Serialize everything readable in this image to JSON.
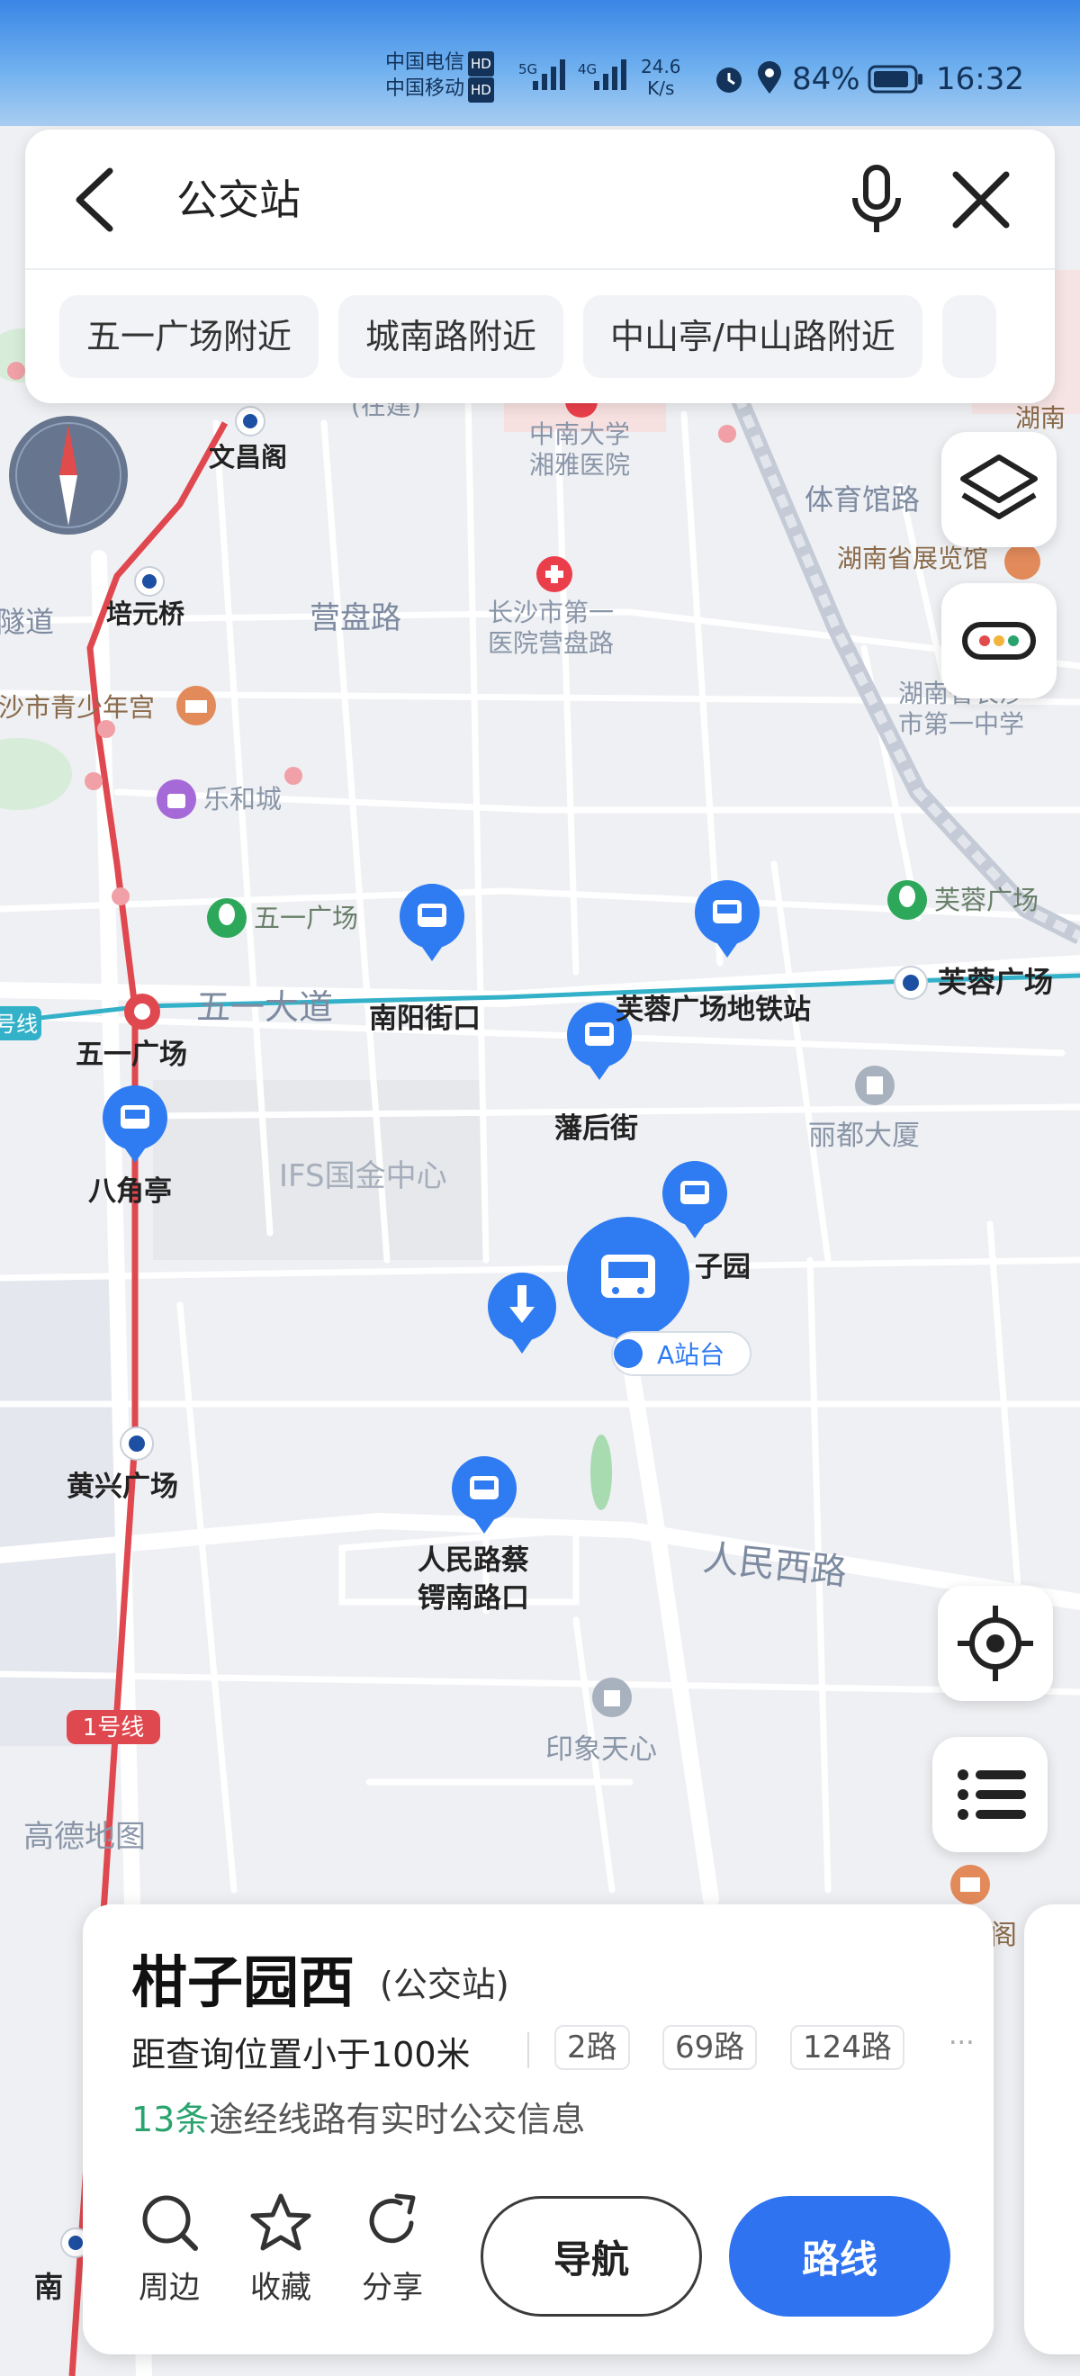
{
  "status_bar": {
    "carrier1": "中国电信",
    "carrier2": "中国移动",
    "hd": "HD",
    "net1": "5G",
    "net2": "4G",
    "speed_value": "24.6",
    "speed_unit": "K/s",
    "battery": "84%",
    "time": "16:32"
  },
  "search": {
    "query": "公交站",
    "chips": [
      "五一广场附近",
      "城南路附近",
      "中山亭/中山路附近"
    ]
  },
  "map": {
    "watermark": "高德地图",
    "labels": {
      "wenchangge": "文昌阁",
      "peiyuanqiao": "培元桥",
      "suidao": "隧道",
      "yingpanlu": "营盘路",
      "xiangya": "中南大学\n湘雅医院",
      "zaijian": "(在建)",
      "tiyuguan": "体育馆路",
      "hospital1": "长沙市第一\n医院营盘路",
      "zhanlanguan": "湖南省展览馆",
      "hunan_prefix": "湖南",
      "school1": "湖南省长沙\n市第一中学",
      "youthpalace": "沙市青少年宫",
      "leHeCheng": "乐和城",
      "furong_square": "芙蓉广场",
      "wuyi_square_poi": "五一广场",
      "wuyi_avenue": "五一大道",
      "line_tag": "号线",
      "nanyangjiekou": "南阳街口",
      "furong_metro": "芙蓉广场地铁站",
      "furong_metro_station": "芙蓉广场",
      "wuyi_metro": "五一广场",
      "fanhoujie": "藩后街",
      "liduDasha": "丽都大厦",
      "bajiaoting": "八角亭",
      "ifs": "IFS国金中心",
      "ziyuan": "子园",
      "a_platform": "A站台",
      "huangxing": "黄兴广场",
      "renmin_stop": "人民路蔡\n锷南路口",
      "renmin_road": "人民西路",
      "yinxiang": "印象天心",
      "line1": "1号线",
      "ge": "阁",
      "nan": "南"
    }
  },
  "card": {
    "name": "柑子园西",
    "type": "(公交站)",
    "distance": "距查询位置小于100米",
    "routes": [
      "2路",
      "69路",
      "124路"
    ],
    "more": "...",
    "realtime_count": "13条",
    "realtime_text": "途经线路有实时公交信息",
    "actions": {
      "nearby": "周边",
      "favorite": "收藏",
      "share": "分享"
    },
    "navigate": "导航",
    "route": "路线"
  },
  "colors": {
    "accent": "#2f73f0",
    "bus_pin": "#2f7bf2",
    "metro_line1": "#e0484f",
    "metro_line2": "#33b1c9",
    "realtime": "#2aa36e"
  }
}
